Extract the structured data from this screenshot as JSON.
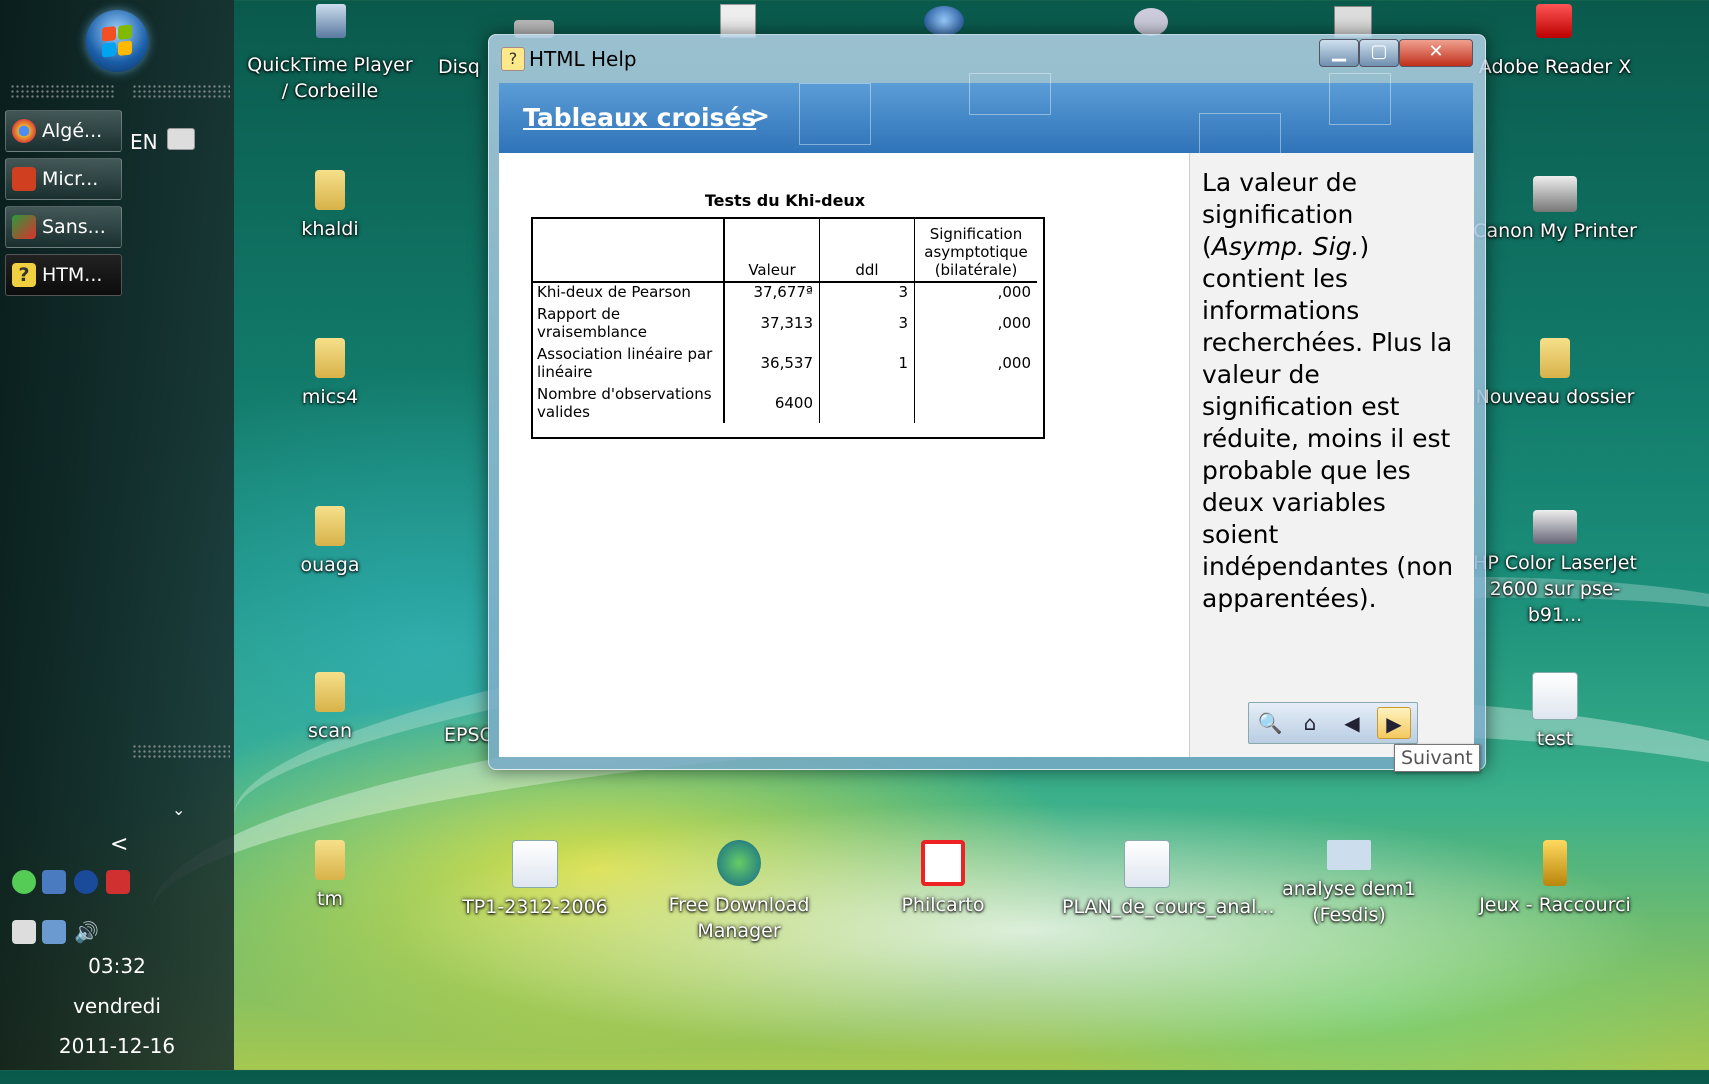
{
  "taskbar": {
    "tasks": [
      {
        "label": "Algé...",
        "color": "#e8b030"
      },
      {
        "label": "Micr...",
        "color": "#d04020"
      },
      {
        "label": "Sans...",
        "color": "#2a9a3a"
      },
      {
        "label": "HTM...",
        "color": "#f0d040"
      }
    ],
    "language": "EN",
    "clock": {
      "time": "03:32",
      "day": "vendredi",
      "date": "2011-12-16"
    }
  },
  "desktop": {
    "icons": [
      {
        "label": "QuickTime Player / Corbeille"
      },
      {
        "label": "khaldi"
      },
      {
        "label": "mics4"
      },
      {
        "label": "ouaga"
      },
      {
        "label": "scan"
      },
      {
        "label": "tm"
      },
      {
        "label": "Disq"
      },
      {
        "label": "EPSC"
      },
      {
        "label": "TP1-2312-2006"
      },
      {
        "label": "Free Download Manager"
      },
      {
        "label": "Philcarto"
      },
      {
        "label": "PLAN_de_cours_anal..."
      },
      {
        "label": "analyse dem1 (Fesdis)"
      },
      {
        "label": "Jeux - Raccourci"
      },
      {
        "label": "Adobe Reader X"
      },
      {
        "label": "Canon My Printer"
      },
      {
        "label": "Nouveau dossier"
      },
      {
        "label": "HP Color LaserJet 2600 sur pse-b91..."
      },
      {
        "label": "test"
      }
    ]
  },
  "help_window": {
    "title": "HTML Help",
    "breadcrumb": "Tableaux croisés",
    "breadcrumb_arrow": ">",
    "table": {
      "title": "Tests du Khi-deux",
      "headers": [
        "",
        "Valeur",
        "ddl",
        "Signification asymptotique (bilatérale)"
      ],
      "rows": [
        [
          "Khi-deux de Pearson",
          "37,677ª",
          "3",
          ",000"
        ],
        [
          "Rapport de vraisemblance",
          "37,313",
          "3",
          ",000"
        ],
        [
          "Association linéaire par linéaire",
          "36,537",
          "1",
          ",000"
        ],
        [
          "Nombre d'observations valides",
          "6400",
          "",
          ""
        ]
      ]
    },
    "explanation": {
      "part1": "La valeur de signification (",
      "italic": "Asymp. Sig.",
      "part2": ") contient les informations recherchées. Plus la valeur de signification est réduite, moins il est probable que les deux variables soient indépendantes (non apparentées)."
    },
    "nav": {
      "search_icon": "search-icon",
      "home_icon": "home-icon",
      "back_icon": "back-icon",
      "next_icon": "next-icon",
      "tooltip": "Suivant"
    }
  }
}
